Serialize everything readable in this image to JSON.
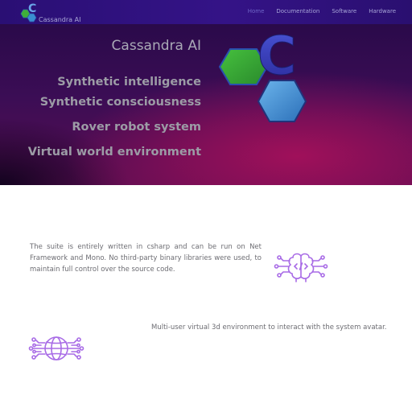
{
  "nav": {
    "brand_name": "Cassandra AI",
    "brand_logo_icon": "hexagon-c-logo",
    "links": [
      {
        "label": "Home",
        "active": true
      },
      {
        "label": "Documentation",
        "active": false
      },
      {
        "label": "Software",
        "active": false
      },
      {
        "label": "Hardware",
        "active": false
      }
    ]
  },
  "hero": {
    "title": "Cassandra AI",
    "lines": [
      "Synthetic intelligence",
      "Synthetic consciousness",
      "Rover robot system",
      "Virtual world environment"
    ],
    "logo_icon": "hexagon-c-logo"
  },
  "features": [
    {
      "text": "The suite is entirely written in csharp and can be run on Net Framework and Mono. No third-party binary libraries were used, to maintain full control over the source code.",
      "icon": "brain-code-icon"
    },
    {
      "text": "Multi-user virtual 3d environment to interact with the system avatar.",
      "icon": "globe-network-icon"
    }
  ],
  "colors": {
    "navbar": "#341387",
    "hexagon_green": "#3fae3a",
    "hexagon_blue": "#3a8fd0",
    "letter_c": "#3c3fbf",
    "icon_purple": "#a86be6"
  }
}
